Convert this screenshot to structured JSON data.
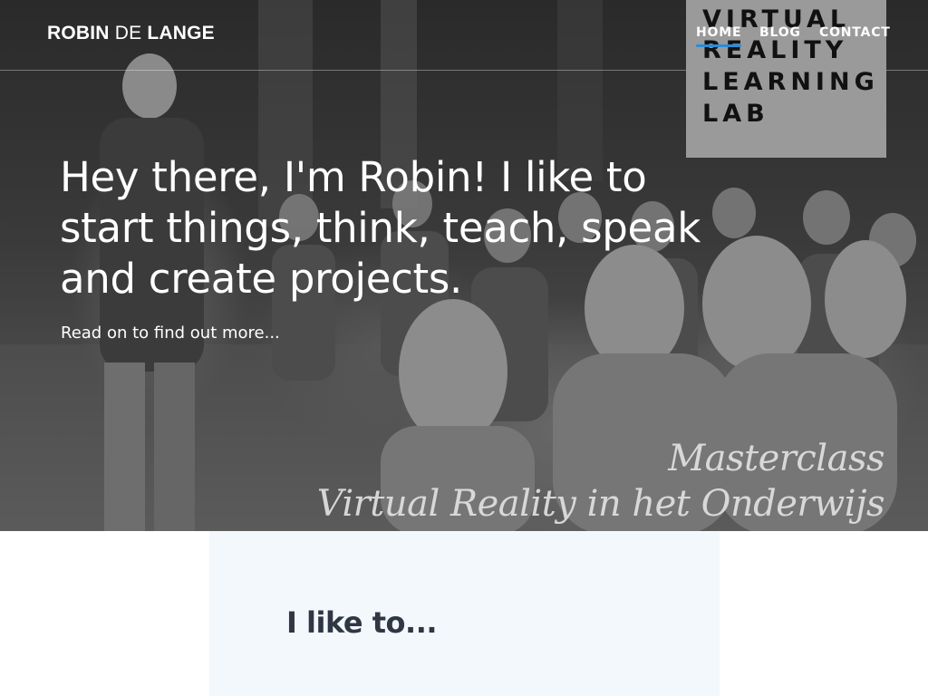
{
  "brand": {
    "part1": "ROBIN",
    "part2": "DE",
    "part3": "LANGE"
  },
  "logo": {
    "lines": [
      "VIRTUAL",
      "REALITY",
      "LEARNING",
      "LAB"
    ]
  },
  "nav": {
    "items": [
      {
        "label": "HOME",
        "active": true
      },
      {
        "label": "BLOG",
        "active": false
      },
      {
        "label": "CONTACT",
        "active": false
      }
    ],
    "accent_color": "#2a8cd8"
  },
  "hero": {
    "headline": "Hey there, I'm Robin! I like to start things, think, teach, speak and create projects.",
    "read_more": "Read on to find out more...",
    "photo_caption_line1": "Masterclass",
    "photo_caption_line2": "Virtual Reality in het Onderwijs"
  },
  "section": {
    "title": "I like to..."
  },
  "colors": {
    "panel_bg": "#f3f8fc",
    "title_text": "#2f3744",
    "logo_bg": "#9a9a9a"
  }
}
